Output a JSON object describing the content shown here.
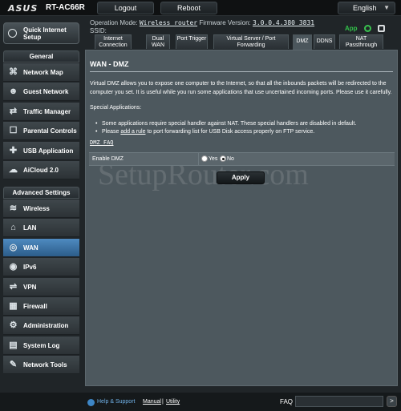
{
  "header": {
    "logo": "ASUS",
    "model": "RT-AC66R",
    "logout_label": "Logout",
    "reboot_label": "Reboot",
    "language": "English"
  },
  "info": {
    "operation_mode_label": "Operation Mode:",
    "operation_mode_value": "Wireless router",
    "firmware_label": "Firmware Version:",
    "firmware_value": "3.0.0.4.380_3831",
    "ssid_label": "SSID:",
    "app_label": "App"
  },
  "sidebar": {
    "quick_setup": "Quick Internet Setup",
    "general_header": "General",
    "general_items": [
      {
        "label": "Network Map",
        "icon": "network-map-icon"
      },
      {
        "label": "Guest Network",
        "icon": "guest-network-icon"
      },
      {
        "label": "Traffic Manager",
        "icon": "traffic-manager-icon"
      },
      {
        "label": "Parental Controls",
        "icon": "parental-controls-icon"
      },
      {
        "label": "USB Application",
        "icon": "usb-application-icon"
      },
      {
        "label": "AiCloud 2.0",
        "icon": "aicloud-icon"
      }
    ],
    "advanced_header": "Advanced Settings",
    "advanced_items": [
      {
        "label": "Wireless",
        "icon": "wireless-icon"
      },
      {
        "label": "LAN",
        "icon": "lan-icon"
      },
      {
        "label": "WAN",
        "icon": "wan-icon",
        "active": true
      },
      {
        "label": "IPv6",
        "icon": "ipv6-icon"
      },
      {
        "label": "VPN",
        "icon": "vpn-icon"
      },
      {
        "label": "Firewall",
        "icon": "firewall-icon"
      },
      {
        "label": "Administration",
        "icon": "administration-icon"
      },
      {
        "label": "System Log",
        "icon": "system-log-icon"
      },
      {
        "label": "Network Tools",
        "icon": "network-tools-icon"
      }
    ]
  },
  "tabs": [
    {
      "label": "Internet Connection"
    },
    {
      "label": "Dual WAN"
    },
    {
      "label": "Port Trigger"
    },
    {
      "label": "Virtual Server / Port Forwarding"
    },
    {
      "label": "DMZ",
      "active": true
    },
    {
      "label": "DDNS"
    },
    {
      "label": "NAT Passthrough"
    }
  ],
  "main": {
    "title": "WAN - DMZ",
    "description": "Virtual DMZ allows you to expose one computer to the Internet, so that all the inbounds packets will be redirected to the computer you set. It is useful while you run some applications that use uncertained incoming ports. Please use it carefully.",
    "special_header": "Special Applications:",
    "bullet_1": "Some applications require special handler against NAT. These special handlers are disabled in default.",
    "bullet_2_prefix": "Please ",
    "bullet_2_link": "add a rule",
    "bullet_2_suffix": " to port forwarding list for USB Disk access properly on FTP service.",
    "faq_link": "DMZ FAQ",
    "enable_label": "Enable DMZ",
    "yes_label": "Yes",
    "no_label": "No",
    "selected": "No",
    "apply_label": "Apply"
  },
  "watermark": "SetupRouter.com",
  "footer": {
    "help_label": "Help & Support",
    "manual_label": "Manual",
    "separator": "|",
    "utility_label": "Utility",
    "faq_label": "FAQ",
    "go_label": ">"
  }
}
